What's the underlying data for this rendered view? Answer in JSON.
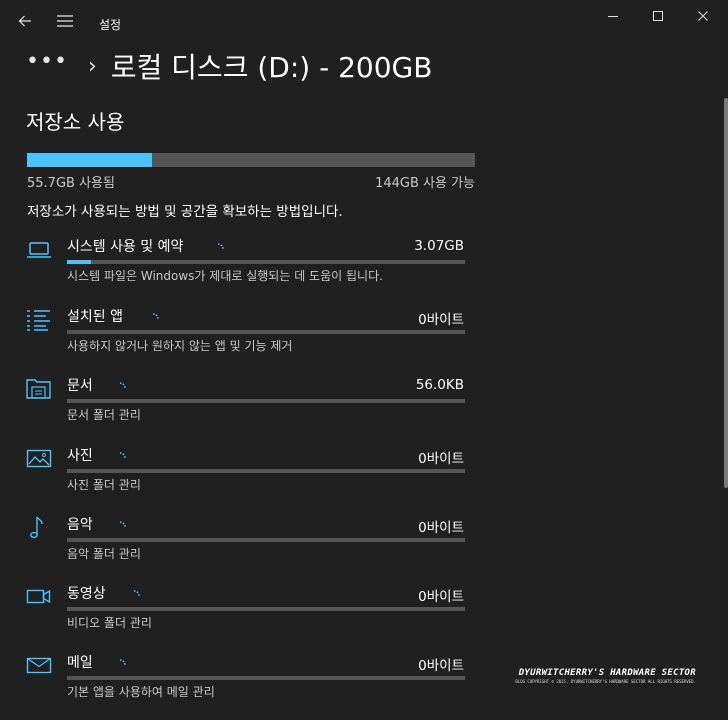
{
  "app": {
    "title": "설정"
  },
  "header": {
    "more": "•••",
    "title": "로컬 디스크 (D:) - 200GB"
  },
  "storage": {
    "title": "저장소 사용",
    "used_fraction": 0.279,
    "used_label": "55.7GB 사용됨",
    "free_label": "144GB 사용 가능",
    "description": "저장소가 사용되는 방법 및 공간을 확보하는 방법입니다."
  },
  "categories": [
    {
      "icon": "laptop-icon",
      "name": "시스템 사용 및 예약",
      "size": "3.07GB",
      "fraction": 0.06,
      "sub": "시스템 파일은 Windows가 제대로 실행되는 데 도움이 됩니다."
    },
    {
      "icon": "apps-list-icon",
      "name": "설치된 앱",
      "size": "0바이트",
      "fraction": 0,
      "sub": "사용하지 않거나 원하지 않는 앱 및 기능 제거"
    },
    {
      "icon": "documents-folder-icon",
      "name": "문서",
      "size": "56.0KB",
      "fraction": 0,
      "sub": "문서 폴더 관리"
    },
    {
      "icon": "pictures-icon",
      "name": "사진",
      "size": "0바이트",
      "fraction": 0,
      "sub": "사진 폴더 관리"
    },
    {
      "icon": "music-note-icon",
      "name": "음악",
      "size": "0바이트",
      "fraction": 0,
      "sub": "음악 폴더 관리"
    },
    {
      "icon": "video-camera-icon",
      "name": "동영상",
      "size": "0바이트",
      "fraction": 0,
      "sub": "비디오 폴더 관리"
    },
    {
      "icon": "mail-icon",
      "name": "메일",
      "size": "0바이트",
      "fraction": 0,
      "sub": "기본 앱을 사용하여 메일 관리"
    }
  ],
  "watermark": {
    "line1": "DYURWITCHERRY'S HARDWARE SECTOR",
    "line2": "BLOG COPYRIGHT © 2015, DYURWITCHERRY'S HARDWARE SECTOR ALL RIGHTS RESERVED."
  },
  "colors": {
    "accent": "#4cc2ff",
    "background": "#202020",
    "track": "#555555"
  }
}
